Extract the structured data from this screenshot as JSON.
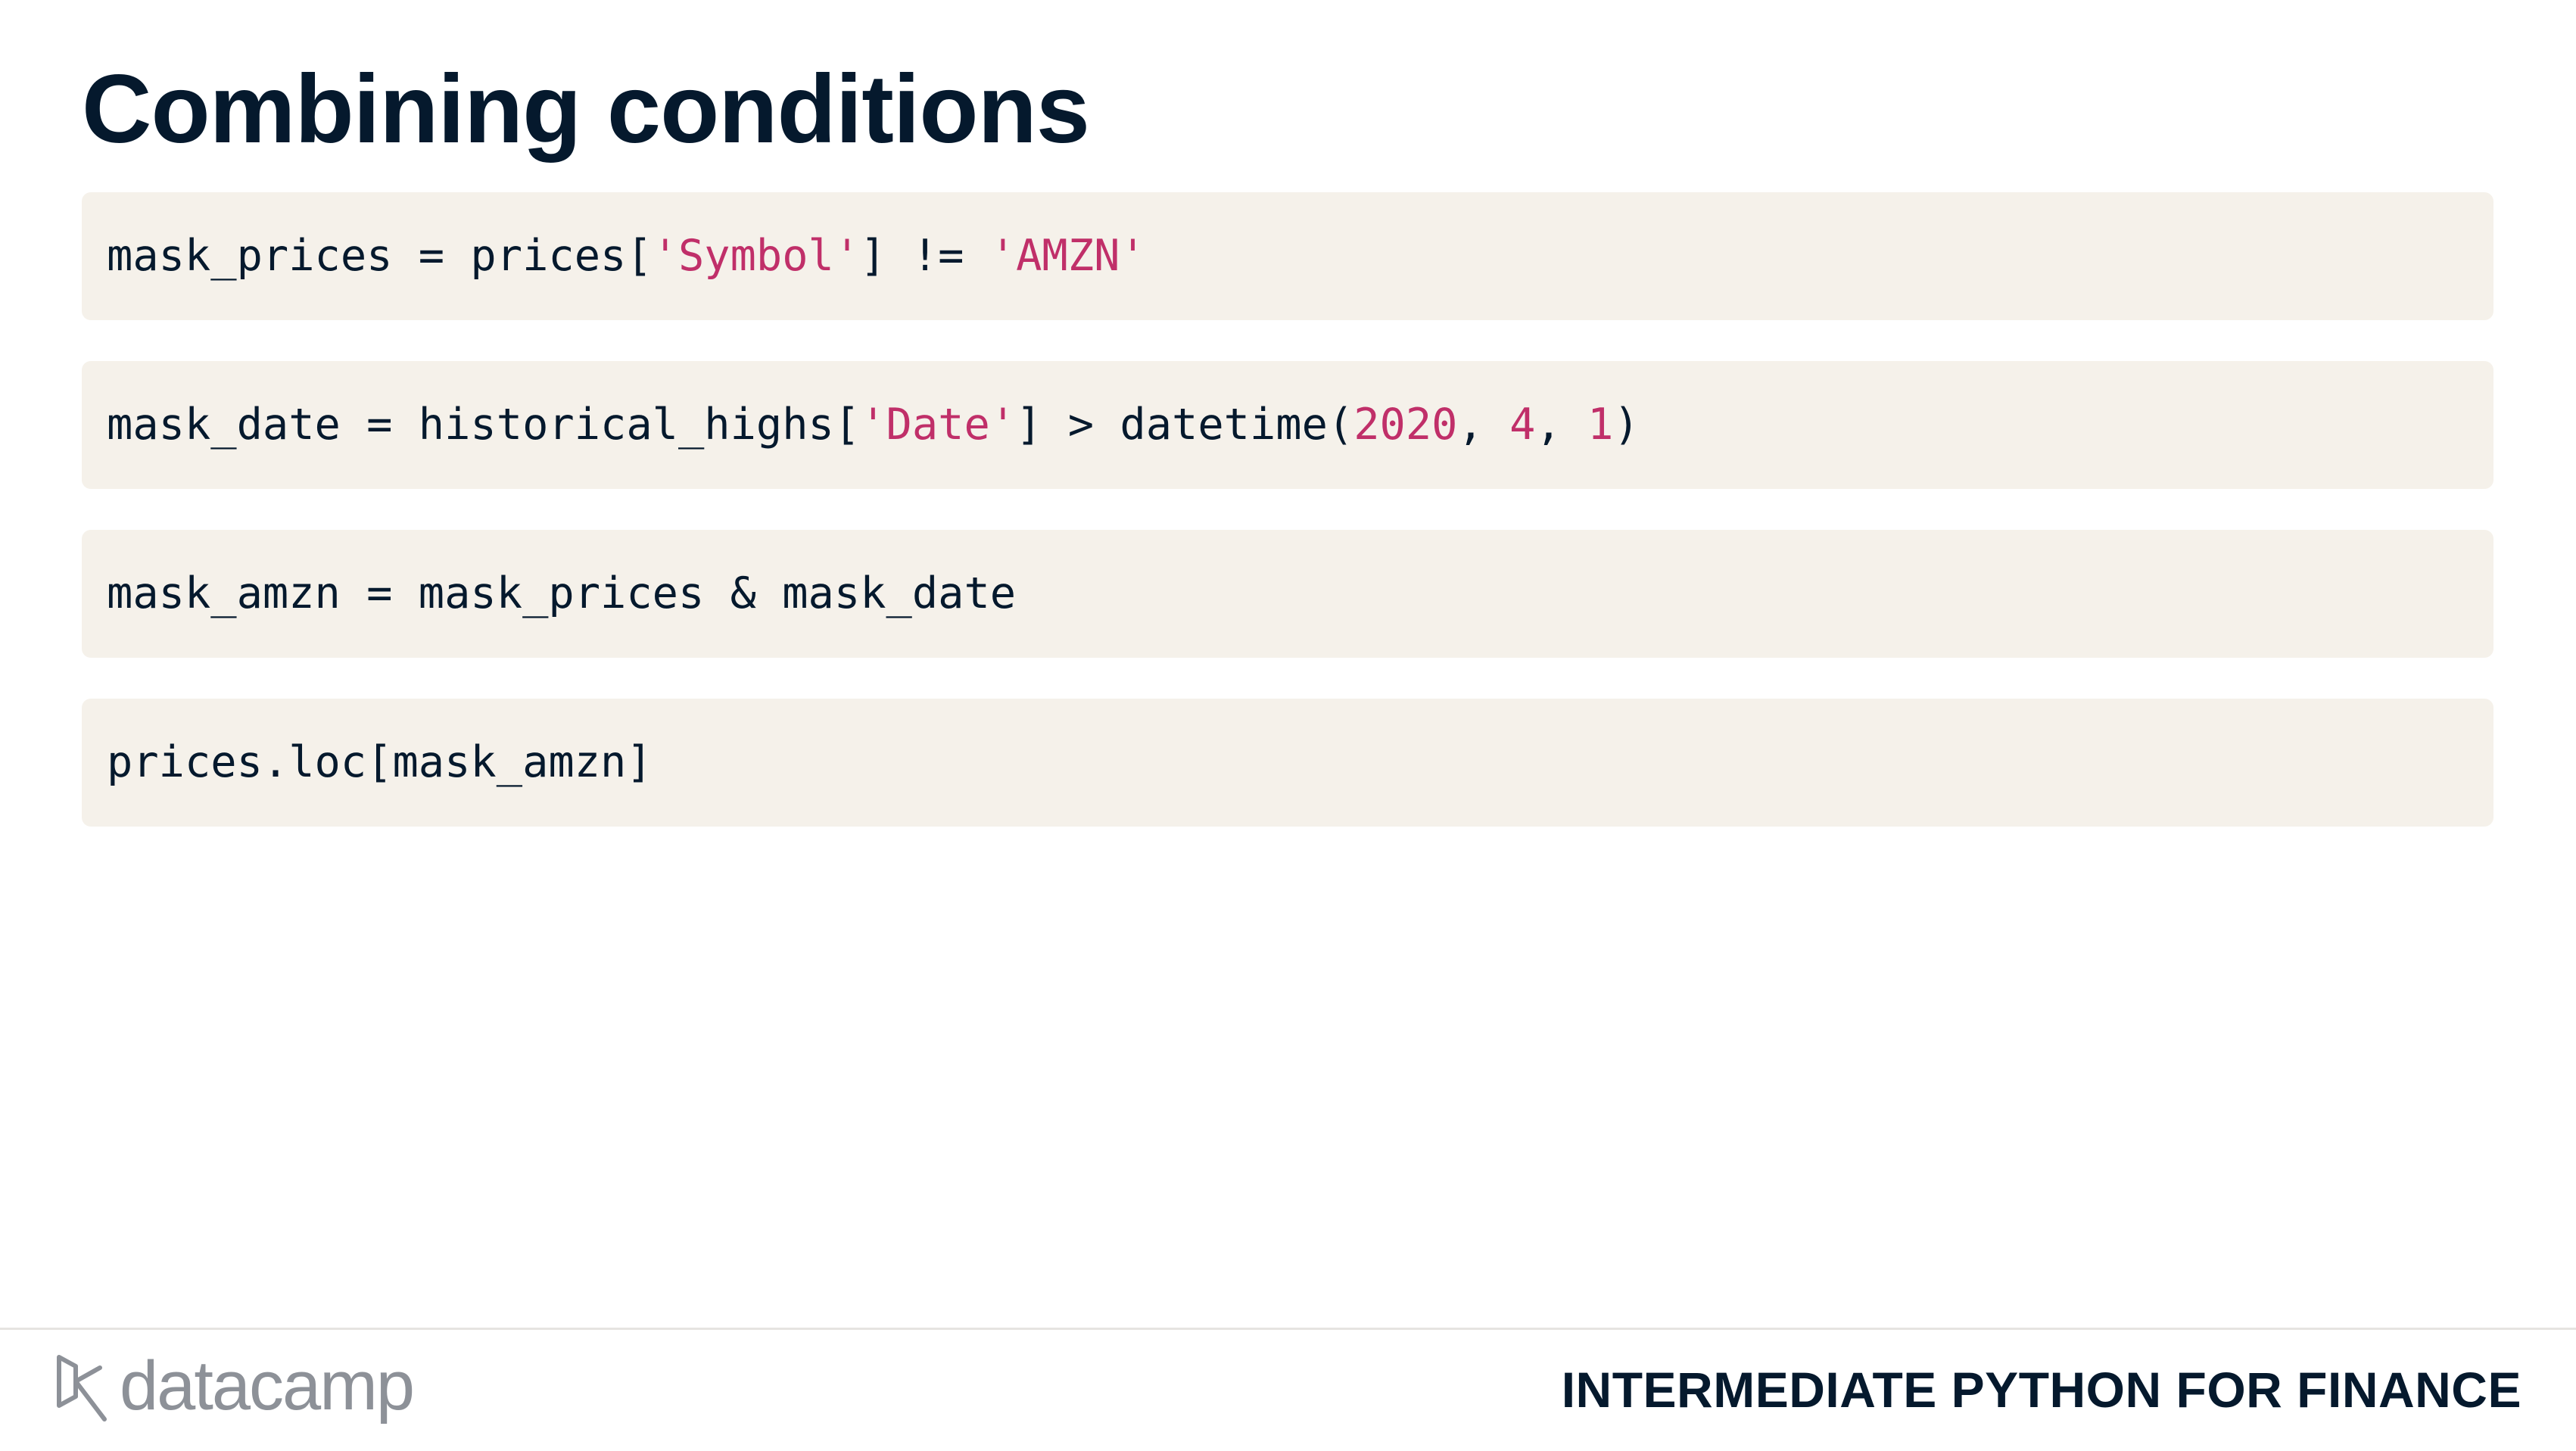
{
  "slide": {
    "title": "Combining conditions"
  },
  "code_blocks": [
    {
      "tokens": [
        {
          "text": "mask_prices = prices[",
          "kind": "plain"
        },
        {
          "text": "'Symbol'",
          "kind": "str"
        },
        {
          "text": "] != ",
          "kind": "plain"
        },
        {
          "text": "'AMZN'",
          "kind": "str"
        }
      ]
    },
    {
      "tokens": [
        {
          "text": "mask_date = historical_highs[",
          "kind": "plain"
        },
        {
          "text": "'Date'",
          "kind": "str"
        },
        {
          "text": "] > datetime(",
          "kind": "plain"
        },
        {
          "text": "2020",
          "kind": "num"
        },
        {
          "text": ", ",
          "kind": "plain"
        },
        {
          "text": "4",
          "kind": "num"
        },
        {
          "text": ", ",
          "kind": "plain"
        },
        {
          "text": "1",
          "kind": "num"
        },
        {
          "text": ")",
          "kind": "plain"
        }
      ]
    },
    {
      "tokens": [
        {
          "text": "mask_amzn = mask_prices & mask_date",
          "kind": "plain"
        }
      ]
    },
    {
      "tokens": [
        {
          "text": "prices.loc[mask_amzn]",
          "kind": "plain"
        }
      ]
    }
  ],
  "footer": {
    "logo_text": "datacamp",
    "logo_icon": "datacamp-logo-icon",
    "course_name": "INTERMEDIATE PYTHON FOR FINANCE"
  },
  "colors": {
    "text": "#05192d",
    "code_bg": "#f5f1ea",
    "string": "#c02f69",
    "logo": "#8d9198"
  }
}
